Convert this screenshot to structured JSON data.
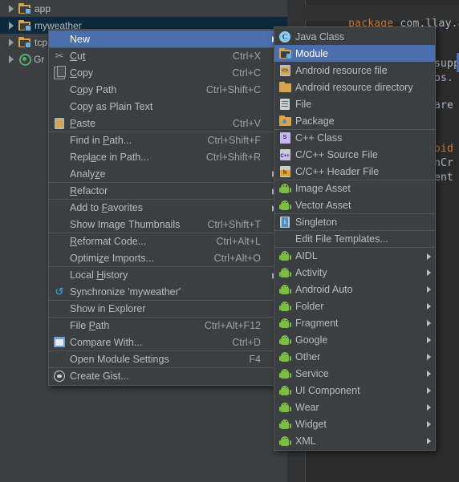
{
  "editor": {
    "code_keyword": "package",
    "code_rest": " com.llay.a",
    "fragments": [
      "supp",
      "os.",
      "are",
      "oid",
      "nCr",
      "ent"
    ]
  },
  "project_tree": {
    "items": [
      {
        "label": "app",
        "icon": "module-folder-icon",
        "selected": false,
        "indent": 0
      },
      {
        "label": "myweather",
        "icon": "module-folder-icon",
        "selected": true,
        "indent": 0
      },
      {
        "label": "tcp",
        "icon": "module-folder-icon",
        "selected": false,
        "indent": 0
      },
      {
        "label": "Gr",
        "icon": "gradle-icon",
        "selected": false,
        "indent": 0
      }
    ]
  },
  "context_menu": {
    "items": [
      {
        "label": "New",
        "accel": "",
        "icon": "",
        "submenu": true,
        "selected": true,
        "separator": false
      },
      {
        "label": "Cut",
        "accel": "Ctrl+X",
        "icon": "scissors-icon",
        "submenu": false,
        "selected": false,
        "separator": true
      },
      {
        "label": "Copy",
        "accel": "Ctrl+C",
        "icon": "copy-icon",
        "submenu": false,
        "selected": false,
        "separator": false
      },
      {
        "label": "Copy Path",
        "accel": "Ctrl+Shift+C",
        "icon": "",
        "submenu": false,
        "selected": false,
        "separator": false
      },
      {
        "label": "Copy as Plain Text",
        "accel": "",
        "icon": "",
        "submenu": false,
        "selected": false,
        "separator": false
      },
      {
        "label": "Paste",
        "accel": "Ctrl+V",
        "icon": "paste-icon",
        "submenu": false,
        "selected": false,
        "separator": false
      },
      {
        "label": "Find in Path...",
        "accel": "Ctrl+Shift+F",
        "icon": "",
        "submenu": false,
        "selected": false,
        "separator": true
      },
      {
        "label": "Replace in Path...",
        "accel": "Ctrl+Shift+R",
        "icon": "",
        "submenu": false,
        "selected": false,
        "separator": false
      },
      {
        "label": "Analyze",
        "accel": "",
        "icon": "",
        "submenu": true,
        "selected": false,
        "separator": false
      },
      {
        "label": "Refactor",
        "accel": "",
        "icon": "",
        "submenu": true,
        "selected": false,
        "separator": true
      },
      {
        "label": "Add to Favorites",
        "accel": "",
        "icon": "",
        "submenu": true,
        "selected": false,
        "separator": true
      },
      {
        "label": "Show Image Thumbnails",
        "accel": "Ctrl+Shift+T",
        "icon": "",
        "submenu": false,
        "selected": false,
        "separator": false
      },
      {
        "label": "Reformat Code...",
        "accel": "Ctrl+Alt+L",
        "icon": "",
        "submenu": false,
        "selected": false,
        "separator": true
      },
      {
        "label": "Optimize Imports...",
        "accel": "Ctrl+Alt+O",
        "icon": "",
        "submenu": false,
        "selected": false,
        "separator": false
      },
      {
        "label": "Local History",
        "accel": "",
        "icon": "",
        "submenu": true,
        "selected": false,
        "separator": true
      },
      {
        "label": "Synchronize 'myweather'",
        "accel": "",
        "icon": "sync-icon",
        "submenu": false,
        "selected": false,
        "separator": false
      },
      {
        "label": "Show in Explorer",
        "accel": "",
        "icon": "",
        "submenu": false,
        "selected": false,
        "separator": true
      },
      {
        "label": "File Path",
        "accel": "Ctrl+Alt+F12",
        "icon": "",
        "submenu": false,
        "selected": false,
        "separator": true
      },
      {
        "label": "Compare With...",
        "accel": "Ctrl+D",
        "icon": "compare-icon",
        "submenu": false,
        "selected": false,
        "separator": false
      },
      {
        "label": "Open Module Settings",
        "accel": "F4",
        "icon": "",
        "submenu": false,
        "selected": false,
        "separator": true
      },
      {
        "label": "Create Gist...",
        "accel": "",
        "icon": "gist-icon",
        "submenu": false,
        "selected": false,
        "separator": true
      }
    ]
  },
  "new_submenu": {
    "items": [
      {
        "label": "Java Class",
        "icon": "java-class-icon",
        "submenu": false,
        "selected": false,
        "separator": false
      },
      {
        "label": "Module",
        "icon": "module-folder-icon",
        "submenu": false,
        "selected": true,
        "separator": false
      },
      {
        "label": "Android resource file",
        "icon": "android-resource-file-icon",
        "submenu": false,
        "selected": false,
        "separator": false
      },
      {
        "label": "Android resource directory",
        "icon": "folder-icon",
        "submenu": false,
        "selected": false,
        "separator": false
      },
      {
        "label": "File",
        "icon": "file-icon",
        "submenu": false,
        "selected": false,
        "separator": false
      },
      {
        "label": "Package",
        "icon": "package-icon",
        "submenu": false,
        "selected": false,
        "separator": false
      },
      {
        "label": "C++ Class",
        "icon": "cpp-class-icon",
        "submenu": false,
        "selected": false,
        "separator": true
      },
      {
        "label": "C/C++ Source File",
        "icon": "cpp-source-icon",
        "submenu": false,
        "selected": false,
        "separator": false
      },
      {
        "label": "C/C++ Header File",
        "icon": "cpp-header-icon",
        "submenu": false,
        "selected": false,
        "separator": false
      },
      {
        "label": "Image Asset",
        "icon": "android-icon",
        "submenu": false,
        "selected": false,
        "separator": true
      },
      {
        "label": "Vector Asset",
        "icon": "android-icon",
        "submenu": false,
        "selected": false,
        "separator": false
      },
      {
        "label": "Singleton",
        "icon": "singleton-icon",
        "submenu": false,
        "selected": false,
        "separator": true
      },
      {
        "label": "Edit File Templates...",
        "icon": "",
        "submenu": false,
        "selected": false,
        "separator": true
      },
      {
        "label": "AIDL",
        "icon": "android-icon",
        "submenu": true,
        "selected": false,
        "separator": true
      },
      {
        "label": "Activity",
        "icon": "android-icon",
        "submenu": true,
        "selected": false,
        "separator": false
      },
      {
        "label": "Android Auto",
        "icon": "android-icon",
        "submenu": true,
        "selected": false,
        "separator": false
      },
      {
        "label": "Folder",
        "icon": "android-icon",
        "submenu": true,
        "selected": false,
        "separator": false
      },
      {
        "label": "Fragment",
        "icon": "android-icon",
        "submenu": true,
        "selected": false,
        "separator": false
      },
      {
        "label": "Google",
        "icon": "android-icon",
        "submenu": true,
        "selected": false,
        "separator": false
      },
      {
        "label": "Other",
        "icon": "android-icon",
        "submenu": true,
        "selected": false,
        "separator": false
      },
      {
        "label": "Service",
        "icon": "android-icon",
        "submenu": true,
        "selected": false,
        "separator": false
      },
      {
        "label": "UI Component",
        "icon": "android-icon",
        "submenu": true,
        "selected": false,
        "separator": false
      },
      {
        "label": "Wear",
        "icon": "android-icon",
        "submenu": true,
        "selected": false,
        "separator": false
      },
      {
        "label": "Widget",
        "icon": "android-icon",
        "submenu": true,
        "selected": false,
        "separator": false
      },
      {
        "label": "XML",
        "icon": "android-icon",
        "submenu": true,
        "selected": false,
        "separator": false
      }
    ]
  },
  "colors": {
    "menu_bg": "#3c3f41",
    "menu_border": "#555759",
    "highlight": "#4b6eaf",
    "tree_selection": "#0d293e",
    "text": "#bbbbbb",
    "accel_text": "#a0a0a0",
    "editor_bg": "#2b2b2b",
    "keyword": "#cc7832",
    "code_text": "#a9b7c6",
    "android_green": "#7cbe42",
    "folder_orange": "#d9a44b"
  }
}
